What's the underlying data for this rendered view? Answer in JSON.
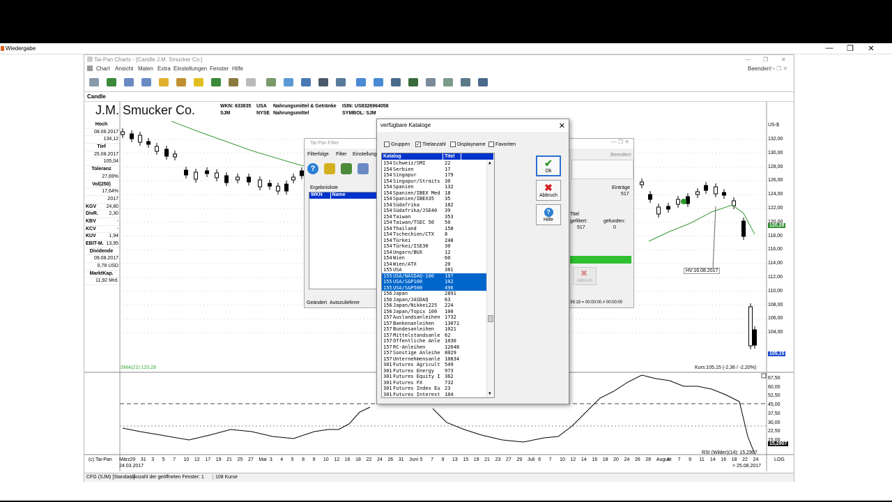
{
  "player": {
    "title": "Wiedergabe",
    "min": "—",
    "max": "❐",
    "close": "✕"
  },
  "app": {
    "title": "Tai-Pan  Charts - [Candle J.M. Smucker Co.]",
    "menu": [
      "Chart",
      "Ansicht",
      "Malen",
      "Extra",
      "Einstellungen",
      "Fenster",
      "Hilfe"
    ],
    "beenden": "Beenden!",
    "tab": "Candle"
  },
  "stock": {
    "company": "J.M. Smucker Co.",
    "wkn": "WKN: 633835",
    "ticker": "SJM",
    "country": "USA",
    "exchange": "NYSE",
    "sector": "Nahrungsmittel & Getränke",
    "sector2": "Nahrungsmittel",
    "isin": "ISIN: US8326964058",
    "symbol": "SYMBOL: SJM"
  },
  "leftpanel": [
    {
      "t": "h",
      "v": "Hoch"
    },
    {
      "t": "v",
      "v": "08.06.2017"
    },
    {
      "t": "v",
      "v": "134,12"
    },
    {
      "t": "h",
      "v": "Tief"
    },
    {
      "t": "v",
      "v": "25.08.2017"
    },
    {
      "t": "v",
      "v": "105,04"
    },
    {
      "t": "h",
      "v": "Toleranz"
    },
    {
      "t": "v",
      "v": "27,69%"
    },
    {
      "t": "h",
      "v": "Vol(250)"
    },
    {
      "t": "v",
      "v": "17,64%"
    },
    {
      "t": "v",
      "v": "2017"
    },
    {
      "t": "kv",
      "k": "KGV",
      "v": "24,80"
    },
    {
      "t": "kv",
      "k": "DivR.",
      "v": "2,30"
    },
    {
      "t": "kv",
      "k": "KBV",
      "v": "-"
    },
    {
      "t": "kv",
      "k": "KCV",
      "v": "-"
    },
    {
      "t": "kv",
      "k": "KUV",
      "v": "1,94"
    },
    {
      "t": "kv",
      "k": "EBIT-M.",
      "v": "13,95"
    },
    {
      "t": "h",
      "v": "Dividende"
    },
    {
      "t": "v",
      "v": "09.08.2017"
    },
    {
      "t": "v",
      "v": "0,78 USD"
    },
    {
      "t": "h",
      "v": "MarktKap."
    },
    {
      "t": "v",
      "v": "11,92 Mrd."
    }
  ],
  "yaxis": {
    "unit": "US-$",
    "labels": [
      "132,00",
      "130,00",
      "128,00",
      "126,00",
      "124,00",
      "122,00",
      "120,00",
      "118,00",
      "116,00",
      "114,00",
      "112,00",
      "110,00",
      "108,00",
      "106,00",
      "104,00"
    ],
    "sma_badge": "120,28",
    "price_badge": "105,15"
  },
  "rsiaxis": {
    "labels": [
      "67,50",
      "60,00",
      "52,50",
      "45,00",
      "37,50",
      "30,00",
      "22,50",
      "15,00"
    ],
    "badge": "15,2907"
  },
  "chart_labels": {
    "sma": "SMA(21):120,28",
    "kurs": "Kurs:105,15 (-2,36 / -2,20%)",
    "hv": "HV:16.08.2017",
    "rsi": "RSI (Wilder)(14): 15,2907",
    "copyright": "(c) Tai-Pan",
    "start_date": "24.03.2017",
    "end_date": "> 25.08.2017",
    "log": "LOG"
  },
  "xaxis": [
    "März",
    "29",
    "31",
    "3",
    "5",
    "7",
    "10",
    "12",
    "17",
    "19",
    "21",
    "25",
    "27",
    "Mai",
    "3",
    "4",
    "5",
    "8",
    "9",
    "10",
    "12",
    "16",
    "18",
    "22",
    "24",
    "26",
    "31",
    "Juni",
    "5",
    "7",
    "9",
    "13",
    "15",
    "19",
    "21",
    "23",
    "27",
    "29",
    "Juli",
    "6",
    "7",
    "10",
    "12",
    "14",
    "16",
    "18",
    "20",
    "24",
    "26",
    "28",
    "August",
    "4",
    "7",
    "9",
    "11",
    "14",
    "16",
    "18",
    "22",
    "24"
  ],
  "statusbar": [
    "CFG (SJM) [Standard]",
    "Anzahl der geöffneten Fenster: 1",
    "108 Kurse"
  ],
  "filterwin": {
    "title": "Tai-Pan  Filter",
    "menu": [
      "Filterfolge",
      "Filter",
      "Einstellung"
    ],
    "ergebnis": "Ergebnisliste",
    "cols": [
      "WKN",
      "Name"
    ],
    "status": [
      "Geändert",
      "Autozulieferer"
    ]
  },
  "rightwin": {
    "beenden": "Beenden!",
    "eintraege_label": "Einträge",
    "eintraege": "517",
    "titel": "Titel",
    "gefiltert_label": "gefiltert:",
    "gefiltert": "517",
    "gefunden_label": "gefunden:",
    "gefunden": "0",
    "abbruch": "Abbruch",
    "time": "39:19 = 00:00:00 # 00:00:00"
  },
  "dialog": {
    "title": "verfügbare Kataloge",
    "checks": [
      {
        "label": "Gruppen",
        "checked": false
      },
      {
        "label": "Titelanzahl",
        "checked": true
      },
      {
        "label": "Displayname",
        "checked": false
      },
      {
        "label": "Favoriten",
        "checked": false
      }
    ],
    "headers": [
      "Katalog",
      "Titel",
      ""
    ],
    "ok": "Ok",
    "abbruch": "Abbruch",
    "hilfe": "Hilfe",
    "rows": [
      [
        "154",
        "Schweiz/SMI",
        "22"
      ],
      [
        "154",
        "Serbien",
        "17"
      ],
      [
        "154",
        "Singapur",
        "179"
      ],
      [
        "154",
        "Singapur/Straits",
        "30"
      ],
      [
        "154",
        "Spanien",
        "132"
      ],
      [
        "154",
        "Spanien/IBEX Med",
        "18"
      ],
      [
        "154",
        "Spanien/IBEX35",
        "35"
      ],
      [
        "154",
        "Südafrika",
        "182"
      ],
      [
        "154",
        "Südafrika/JSE40",
        "39"
      ],
      [
        "154",
        "Taiwan",
        "353"
      ],
      [
        "154",
        "Taiwan/TSEC 50",
        "50"
      ],
      [
        "154",
        "Thailand",
        "158"
      ],
      [
        "154",
        "Tschechien/CTX",
        "8"
      ],
      [
        "154",
        "Türkei",
        "248"
      ],
      [
        "154",
        "Türkei/ISE30",
        "30"
      ],
      [
        "154",
        "Ungarn/BUX",
        "12"
      ],
      [
        "154",
        "Wien",
        "60"
      ],
      [
        "154",
        "Wien/ATX",
        "20"
      ],
      [
        "155",
        "USA",
        "381"
      ],
      [
        "155",
        "USA/NASDAQ-100",
        "107"
      ],
      [
        "155",
        "USA/S&P100",
        "102"
      ],
      [
        "155",
        "USA/S&P500",
        "496"
      ],
      [
        "156",
        "Japan",
        "2891"
      ],
      [
        "156",
        "Japan/JASDAQ",
        "63"
      ],
      [
        "156",
        "Japan/Nikkei225",
        "224"
      ],
      [
        "156",
        "Japan/Topix 100",
        "100"
      ],
      [
        "157",
        "Auslandsanleihen",
        "1732"
      ],
      [
        "157",
        "Bankenanleihen",
        "13071"
      ],
      [
        "157",
        "Bundesanleihen",
        "1021"
      ],
      [
        "157",
        "Mittelstandsanle",
        "62"
      ],
      [
        "157",
        "Öffentliche Anle",
        "1030"
      ],
      [
        "157",
        "RC-Anleihen",
        "12648"
      ],
      [
        "157",
        "Sonstige Anleihe",
        "8029"
      ],
      [
        "157",
        "Unternehmensanle",
        "10834"
      ],
      [
        "301",
        "Futures Agricult",
        "549"
      ],
      [
        "301",
        "Futures Energy",
        "973"
      ],
      [
        "301",
        "Futures Equity I",
        "362"
      ],
      [
        "301",
        "Futures FX",
        "732"
      ],
      [
        "301",
        "Futures Index Eu",
        "23"
      ],
      [
        "301",
        "Futures Interest",
        "104"
      ]
    ],
    "selected": [
      19,
      20,
      21
    ]
  }
}
